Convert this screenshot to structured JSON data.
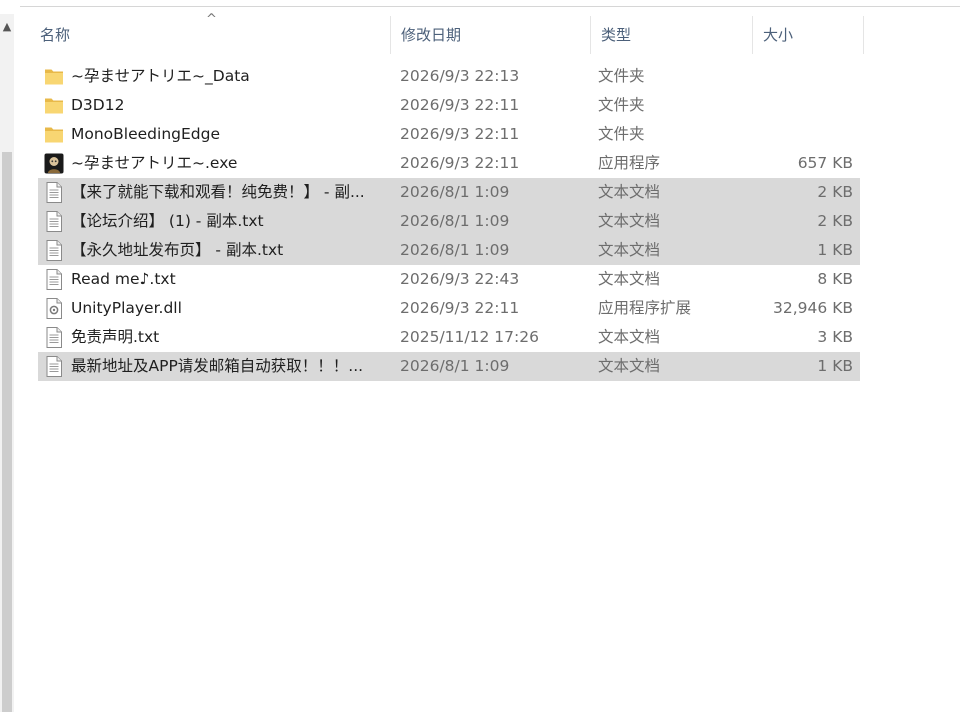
{
  "header": {
    "sort_arrow": "^",
    "columns": {
      "name": "名称",
      "date": "修改日期",
      "type": "类型",
      "size": "大小"
    }
  },
  "files": [
    {
      "name": "~孕ませアトリエ~_Data",
      "date": "2026/9/3 22:13",
      "type": "文件夹",
      "size": "",
      "icon": "folder-icon",
      "selected": false
    },
    {
      "name": "D3D12",
      "date": "2026/9/3 22:11",
      "type": "文件夹",
      "size": "",
      "icon": "folder-icon",
      "selected": false
    },
    {
      "name": "MonoBleedingEdge",
      "date": "2026/9/3 22:11",
      "type": "文件夹",
      "size": "",
      "icon": "folder-icon",
      "selected": false
    },
    {
      "name": "~孕ませアトリエ~.exe",
      "date": "2026/9/3 22:11",
      "type": "应用程序",
      "size": "657 KB",
      "icon": "app-icon",
      "selected": false
    },
    {
      "name": "【来了就能下载和观看！纯免费！】 - 副...",
      "date": "2026/8/1 1:09",
      "type": "文本文档",
      "size": "2 KB",
      "icon": "text-file-icon",
      "selected": true
    },
    {
      "name": "【论坛介绍】 (1) - 副本.txt",
      "date": "2026/8/1 1:09",
      "type": "文本文档",
      "size": "2 KB",
      "icon": "text-file-icon",
      "selected": true
    },
    {
      "name": "【永久地址发布页】 - 副本.txt",
      "date": "2026/8/1 1:09",
      "type": "文本文档",
      "size": "1 KB",
      "icon": "text-file-icon",
      "selected": true
    },
    {
      "name": "Read me♪.txt",
      "date": "2026/9/3 22:43",
      "type": "文本文档",
      "size": "8 KB",
      "icon": "text-file-icon",
      "selected": false
    },
    {
      "name": "UnityPlayer.dll",
      "date": "2026/9/3 22:11",
      "type": "应用程序扩展",
      "size": "32,946 KB",
      "icon": "dll-file-icon",
      "selected": false
    },
    {
      "name": "免责声明.txt",
      "date": "2025/11/12 17:26",
      "type": "文本文档",
      "size": "3 KB",
      "icon": "text-file-icon",
      "selected": false
    },
    {
      "name": "最新地址及APP请发邮箱自动获取！！！...",
      "date": "2026/8/1 1:09",
      "type": "文本文档",
      "size": "1 KB",
      "icon": "text-file-icon",
      "selected": true
    }
  ]
}
